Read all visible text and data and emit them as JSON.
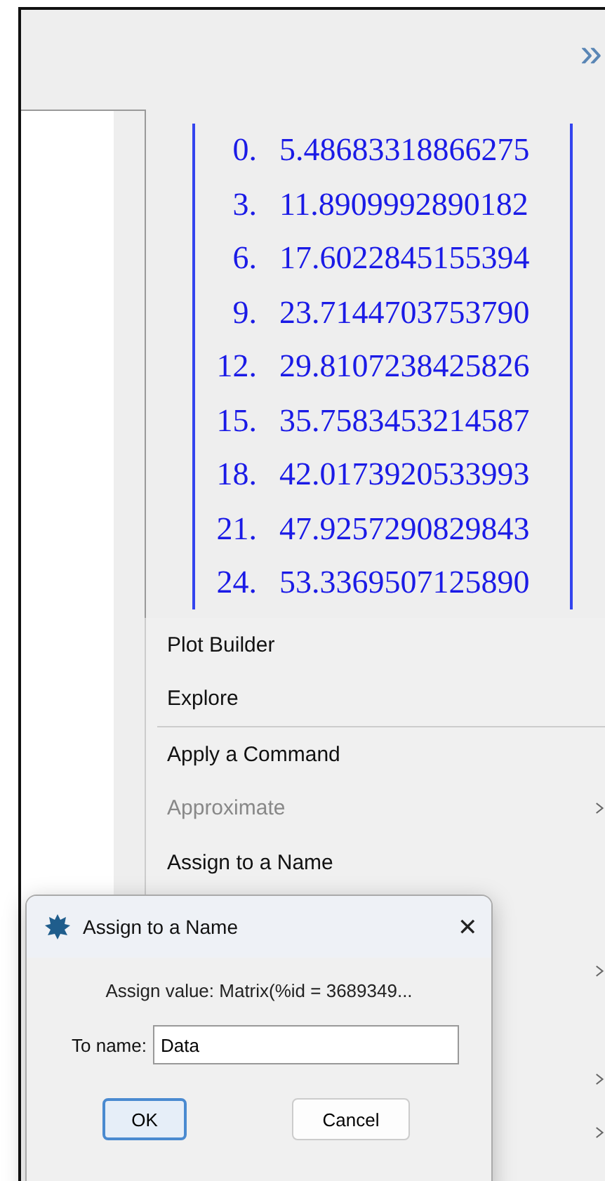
{
  "toolbar": {
    "overflow_label": "»"
  },
  "matrix": {
    "rows": [
      {
        "index": "0.",
        "value": "5.48683318866275"
      },
      {
        "index": "3.",
        "value": "11.8909992890182"
      },
      {
        "index": "6.",
        "value": "17.6022845155394"
      },
      {
        "index": "9.",
        "value": "23.7144703753790"
      },
      {
        "index": "12.",
        "value": "29.8107238425826"
      },
      {
        "index": "15.",
        "value": "35.7583453214587"
      },
      {
        "index": "18.",
        "value": "42.0173920533993"
      },
      {
        "index": "21.",
        "value": "47.9257290829843"
      },
      {
        "index": "24.",
        "value": "53.3369507125890"
      }
    ]
  },
  "context_menu": {
    "items": [
      {
        "label": "Plot Builder",
        "disabled": false,
        "submenu": false,
        "separator_after": false
      },
      {
        "label": "Explore",
        "disabled": false,
        "submenu": false,
        "separator_after": true
      },
      {
        "label": "Apply a Command",
        "disabled": false,
        "submenu": false,
        "separator_after": false
      },
      {
        "label": "Approximate",
        "disabled": true,
        "submenu": true,
        "separator_after": false
      },
      {
        "label": "Assign to a Name",
        "disabled": false,
        "submenu": false,
        "separator_after": false
      },
      {
        "submenu": false,
        "separator_after": false
      },
      {
        "submenu": true,
        "separator_after": false
      },
      {
        "submenu": false,
        "separator_after": false
      },
      {
        "submenu": true,
        "separator_after": false
      },
      {
        "submenu": true,
        "separator_after": false
      }
    ]
  },
  "dialog": {
    "title": "Assign to a Name",
    "close": "✕",
    "message": "Assign value: Matrix(%id = 3689349...",
    "field_label": "To name:",
    "field_value": "Data",
    "buttons": [
      {
        "label": "OK",
        "selected": true
      },
      {
        "label": "Cancel",
        "selected": false
      }
    ]
  }
}
